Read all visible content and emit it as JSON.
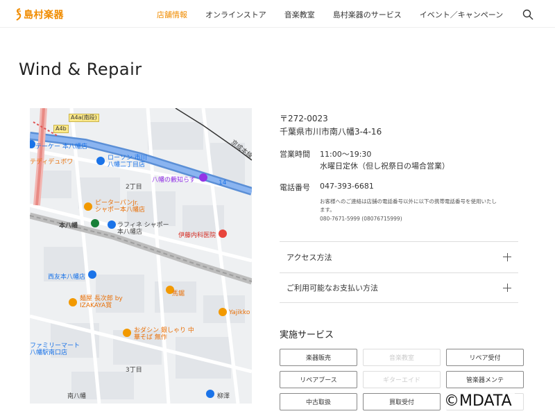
{
  "header": {
    "logo": "島村楽器",
    "nav": [
      "店舗情報",
      "オンラインストア",
      "音楽教室",
      "島村楽器のサービス",
      "イベント／キャンペーン"
    ],
    "active_index": 0,
    "accent_color": "#f08c00"
  },
  "page_title": "Wind & Repair",
  "map": {
    "road_badges": [
      "A4a(南段)",
      "A4b"
    ],
    "labels": {
      "tokei": "テーケー 本八幡店",
      "teddy": "テディデュボワ",
      "lawson": "ローソン 市川\n八幡二丁目店",
      "nichome": "2丁目",
      "yawata_sora": "八幡の藪知らず",
      "peter": "ピーターパンJr.\nシャポー本八幡店",
      "motoyawata_station": "本八幡",
      "laffine": "ラフィネ シャポー\n本八幡店",
      "ito_clinic": "伊藤内科医院",
      "seiyu": "西友本八幡店",
      "bamei": "馬鋸",
      "chojiro": "麺屋 長次郎 by\nIZAKAYA賞",
      "yajikko": "Yajikko",
      "odashin": "おダシン 銀しゃり 中華そば 無作",
      "familymart": "ファミリーマート\n八幡駅南口店",
      "sanchome": "3丁目",
      "minami_yawata": "南八幡",
      "yanagi": "柳澤",
      "keisei": "京成本線",
      "route14": "14"
    }
  },
  "store": {
    "postal": "〒272-0023",
    "address": "千葉県市川市南八幡3-4-16",
    "hours_label": "営業時間",
    "hours": "11:00〜19:30",
    "closed": "水曜日定休（但し祝祭日の場合営業）",
    "phone_label": "電話番号",
    "phone": "047-393-6681",
    "note_line1": "お客様へのご連絡は店舗の電話番号以外に以下の携帯電話番号を使用いたし",
    "note_line2": "ます。",
    "note_line3": "080-7671-5999 (08076715999)"
  },
  "accordions": [
    "アクセス方法",
    "ご利用可能なお支払い方法"
  ],
  "services": {
    "title": "実施サービス",
    "items": [
      {
        "label": "楽器販売",
        "enabled": true
      },
      {
        "label": "音楽教室",
        "enabled": false
      },
      {
        "label": "リペア受付",
        "enabled": true
      },
      {
        "label": "リペアブース",
        "enabled": true
      },
      {
        "label": "ギターエイド",
        "enabled": false
      },
      {
        "label": "管楽器メンテ",
        "enabled": true
      },
      {
        "label": "中古取扱",
        "enabled": true
      },
      {
        "label": "買取受付",
        "enabled": true
      },
      {
        "label": "",
        "enabled": false
      }
    ]
  },
  "watermark": "©MDATA"
}
